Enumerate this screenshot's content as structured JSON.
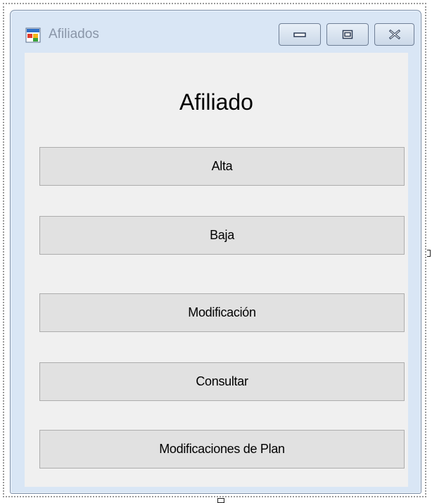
{
  "window": {
    "title": "Afiliados",
    "icon": "form-app-icon",
    "controls": {
      "minimize_icon": "minimize-icon",
      "maximize_icon": "maximize-icon",
      "close_icon": "close-icon"
    }
  },
  "form": {
    "heading": "Afiliado",
    "buttons": [
      {
        "label": "Alta"
      },
      {
        "label": "Baja"
      },
      {
        "label": "Modificación"
      },
      {
        "label": "Consultar"
      },
      {
        "label": "Modificaciones de Plan"
      }
    ]
  },
  "colors": {
    "client_background": "#f0f0f0",
    "button_face": "#e1e1e1",
    "button_border": "#adadad",
    "window_frame": "#d9e6f5"
  }
}
